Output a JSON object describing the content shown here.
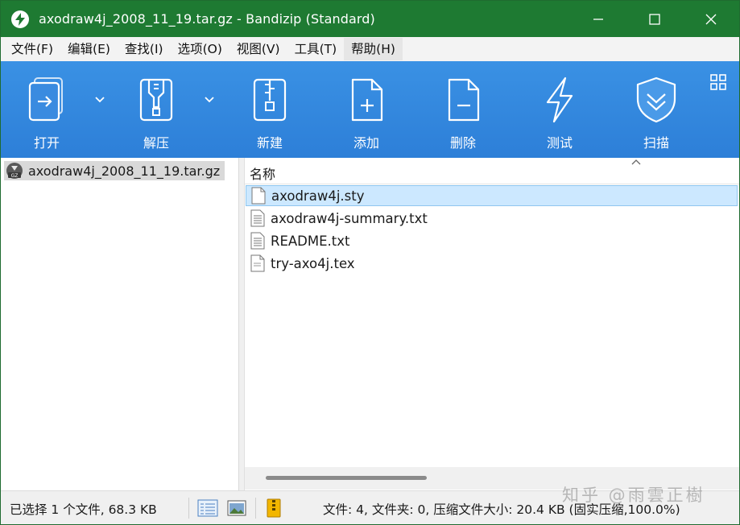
{
  "window": {
    "title": "axodraw4j_2008_11_19.tar.gz - Bandizip (Standard)",
    "accent_color": "#1e7a32",
    "controls": [
      {
        "name": "minimize-icon",
        "glyph": "—"
      },
      {
        "name": "maximize-icon",
        "glyph": "☐"
      },
      {
        "name": "close-icon",
        "glyph": "✕"
      }
    ]
  },
  "menubar": {
    "items": [
      "文件(F)",
      "编辑(E)",
      "查找(I)",
      "选项(O)",
      "视图(V)",
      "工具(T)",
      "帮助(H)"
    ]
  },
  "toolbar": {
    "background_color": "#3a91e4",
    "buttons": [
      {
        "label": "打开",
        "icon": "open-icon",
        "has_dropdown": true
      },
      {
        "label": "解压",
        "icon": "extract-icon",
        "has_dropdown": true
      },
      {
        "label": "新建",
        "icon": "new-archive-icon",
        "has_dropdown": false
      },
      {
        "label": "添加",
        "icon": "add-icon",
        "has_dropdown": false
      },
      {
        "label": "删除",
        "icon": "delete-icon",
        "has_dropdown": false
      },
      {
        "label": "测试",
        "icon": "test-icon",
        "has_dropdown": false
      },
      {
        "label": "扫描",
        "icon": "scan-icon",
        "has_dropdown": false
      }
    ],
    "view_toggle_icon": "grid-view-icon"
  },
  "tree": {
    "items": [
      {
        "label": "axodraw4j_2008_11_19.tar.gz",
        "icon": "gz-archive-icon",
        "selected": true
      }
    ]
  },
  "filelist": {
    "column_name": "名称",
    "sort_icon": "sort-caret-up-icon",
    "files": [
      {
        "name": "axodraw4j.sty",
        "icon": "blank-file-icon",
        "selected": true
      },
      {
        "name": "axodraw4j-summary.txt",
        "icon": "text-file-icon",
        "selected": false
      },
      {
        "name": "README.txt",
        "icon": "text-file-icon",
        "selected": false
      },
      {
        "name": "try-axo4j.tex",
        "icon": "tex-file-icon",
        "selected": false
      }
    ],
    "selection_color": "#cce8ff"
  },
  "statusbar": {
    "selection_info": "已选择 1 个文件, 68.3 KB",
    "archive_info": "文件: 4, 文件夹: 0, 压缩文件大小: 20.4 KB (固实压缩,100.0%)",
    "buttons": [
      "details-view-icon",
      "preview-pane-icon",
      "archive-info-icon"
    ]
  },
  "watermark": {
    "text": "知乎 @雨雲正樹"
  }
}
